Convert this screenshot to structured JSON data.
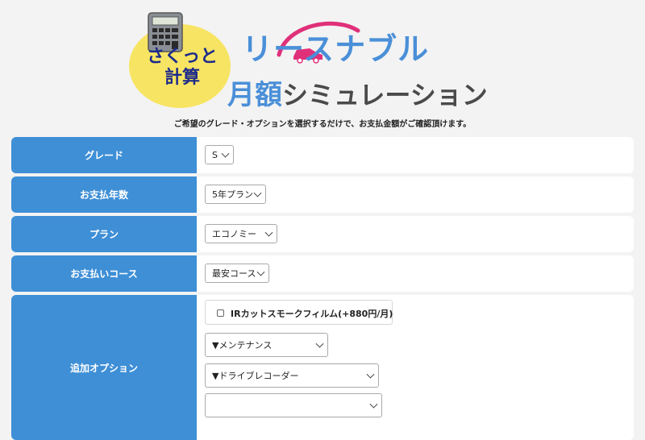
{
  "header": {
    "bubble_line1": "さくっと",
    "bubble_line2": "計算",
    "logo_top": "リースナブル",
    "logo_bottom_blue": "月額",
    "logo_bottom_gray": "シミュレーション",
    "subtitle": "ご希望のグレード・オプションを選択するだけで、お支払金額がご確認頂けます。"
  },
  "form": {
    "grade": {
      "label": "グレード",
      "value": "S"
    },
    "payment_years": {
      "label": "お支払年数",
      "value": "5年プラン"
    },
    "plan": {
      "label": "プラン",
      "value": "エコノミー"
    },
    "course": {
      "label": "お支払いコース",
      "value": "最安コース"
    },
    "options": {
      "label": "追加オプション",
      "ir_film_label": "IRカットスモークフィルム(+880円/月)",
      "maintenance": "▼メンテナンス",
      "drive_recorder": "▼ドライブレコーダー"
    }
  },
  "colors": {
    "label_bg": "#3e8fd6",
    "logo_blue": "#4a8fd8",
    "logo_pink": "#e0307a",
    "bubble_yellow": "#f7e463"
  },
  "icons": [
    "calculator-icon",
    "car-swoosh-icon",
    "chevron-down-icon"
  ]
}
